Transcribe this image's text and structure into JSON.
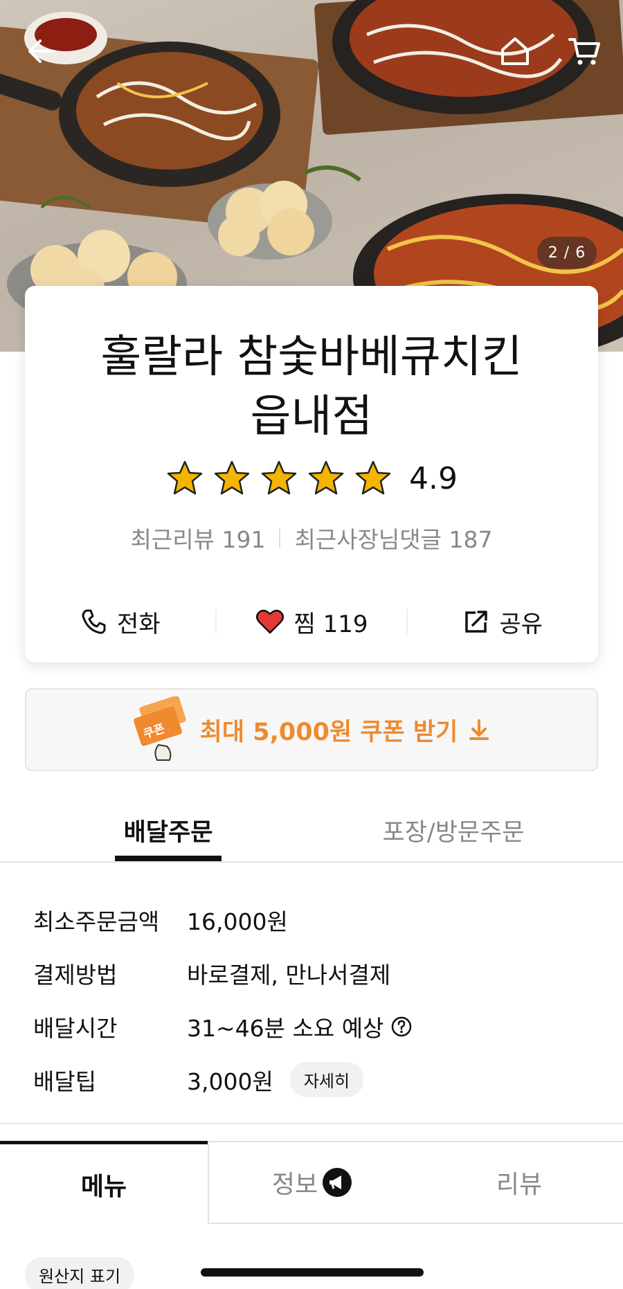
{
  "header": {
    "back_icon": "back-arrow-icon",
    "home_icon": "home-icon",
    "cart_icon": "cart-icon",
    "image_counter": "2 / 6"
  },
  "store": {
    "name_line1": "훌랄라 참숯바베큐치킨",
    "name_line2": "읍내점",
    "rating": "4.9",
    "stars": 5,
    "recent_reviews_label": "최근리뷰",
    "recent_reviews_count": "191",
    "owner_replies_label": "최근사장님댓글",
    "owner_replies_count": "187"
  },
  "actions": {
    "call_label": "전화",
    "like_label": "찜",
    "like_count": "119",
    "share_label": "공유"
  },
  "coupon": {
    "text": "최대 5,000원 쿠폰 받기",
    "ticket_label": "쿠폰"
  },
  "order_tabs": {
    "delivery": "배달주문",
    "pickup": "포장/방문주문"
  },
  "info": {
    "rows": [
      {
        "label": "최소주문금액",
        "value": "16,000원"
      },
      {
        "label": "결제방법",
        "value": "바로결제, 만나서결제"
      },
      {
        "label": "배달시간",
        "value": "31~46분 소요 예상"
      },
      {
        "label": "배달팁",
        "value": "3,000원"
      }
    ],
    "detail_chip": "자세히"
  },
  "menu_tabs": {
    "menu": "메뉴",
    "info": "정보",
    "review": "리뷰"
  },
  "origin_chip": "원산지 표기",
  "colors": {
    "accent_orange": "#ef8a2e",
    "star_gold": "#f4b400",
    "heart_red": "#e53935"
  }
}
